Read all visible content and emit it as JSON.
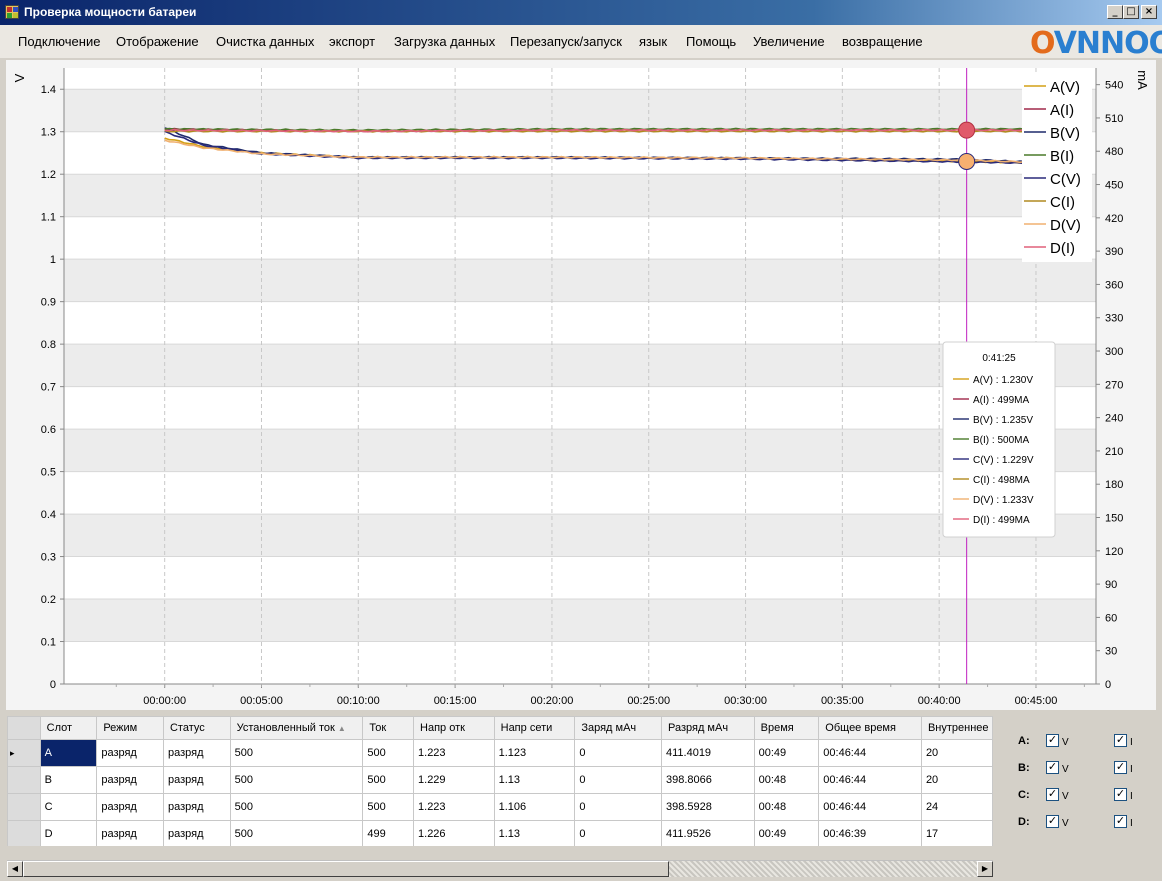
{
  "window": {
    "title": "Проверка мощности батареи",
    "min": "_",
    "max": "□",
    "close": "×"
  },
  "menu": [
    "Подключение",
    "Отображение",
    "Очистка данных",
    "экспорт",
    "Загрузка данных",
    "Перезапуск/запуск",
    "язык",
    "Помощь",
    "Увеличение",
    "возвращение"
  ],
  "logo": {
    "text": "OVNNOO"
  },
  "chart_data": {
    "type": "line",
    "ylabel_left": "V",
    "ylabel_right": "mA",
    "ylim_left": [
      0,
      1.45
    ],
    "ylim_right": [
      0,
      555
    ],
    "yticks_left": [
      "1.4",
      "1.3",
      "1.2",
      "1.1",
      "1",
      "0.9",
      "0.8",
      "0.7",
      "0.6",
      "0.5",
      "0.4",
      "0.3",
      "0.2",
      "0.1",
      "0"
    ],
    "yticks_right": [
      "540",
      "510",
      "480",
      "450",
      "420",
      "390",
      "360",
      "330",
      "300",
      "270",
      "240",
      "210",
      "180",
      "150",
      "120",
      "90",
      "60",
      "30",
      "0"
    ],
    "xticks": [
      "00:00:00",
      "00:05:00",
      "00:10:00",
      "00:15:00",
      "00:20:00",
      "00:25:00",
      "00:30:00",
      "00:35:00",
      "00:40:00",
      "00:45:00"
    ],
    "grid": true,
    "legend_position": "top-right",
    "series": [
      {
        "name": "A(V)",
        "axis": "left",
        "color": "#d4a017",
        "x_min": [
          0,
          2,
          5,
          10,
          20,
          30,
          41.4,
          46.7
        ],
        "y": [
          1.285,
          1.265,
          1.25,
          1.24,
          1.24,
          1.238,
          1.23,
          1.225
        ]
      },
      {
        "name": "A(I)",
        "axis": "right",
        "color": "#a0284a",
        "x_min": [
          0,
          10,
          20,
          30,
          41.4,
          46.7
        ],
        "y": [
          500,
          498,
          499,
          499,
          499,
          500
        ]
      },
      {
        "name": "B(V)",
        "axis": "left",
        "color": "#1f2a6b",
        "x_min": [
          0,
          2,
          5,
          10,
          20,
          30,
          41.4,
          46.7
        ],
        "y": [
          1.31,
          1.27,
          1.25,
          1.24,
          1.24,
          1.238,
          1.235,
          1.225
        ]
      },
      {
        "name": "B(I)",
        "axis": "right",
        "color": "#4a7a2a",
        "x_min": [
          0,
          10,
          20,
          30,
          41.4,
          46.7
        ],
        "y": [
          500,
          499,
          500,
          500,
          500,
          500
        ]
      },
      {
        "name": "C(V)",
        "axis": "left",
        "color": "#2a2a7a",
        "x_min": [
          0,
          2,
          5,
          10,
          20,
          30,
          41.4,
          46.7
        ],
        "y": [
          1.3,
          1.268,
          1.248,
          1.238,
          1.238,
          1.236,
          1.229,
          1.224
        ]
      },
      {
        "name": "C(I)",
        "axis": "right",
        "color": "#b08a20",
        "x_min": [
          0,
          10,
          20,
          30,
          41.4,
          46.7
        ],
        "y": [
          498,
          498,
          498,
          498,
          498,
          498
        ]
      },
      {
        "name": "D(V)",
        "axis": "left",
        "color": "#f0b070",
        "x_min": [
          0,
          2,
          5,
          10,
          20,
          30,
          41.4,
          46.7
        ],
        "y": [
          1.28,
          1.262,
          1.248,
          1.24,
          1.24,
          1.238,
          1.233,
          1.226
        ]
      },
      {
        "name": "D(I)",
        "axis": "right",
        "color": "#e0607a",
        "x_min": [
          0,
          10,
          20,
          30,
          41.4,
          46.7
        ],
        "y": [
          499,
          498,
          499,
          499,
          499,
          499
        ]
      }
    ],
    "cursor": {
      "x_min": 41.42,
      "time": "0:41:25"
    },
    "tooltip": {
      "time": "0:41:25",
      "rows": [
        "A(V) : 1.230V",
        "A(I) : 499MA",
        "B(V) : 1.235V",
        "B(I) : 500MA",
        "C(V) : 1.229V",
        "C(I) : 498MA",
        "D(V) : 1.233V",
        "D(I) : 499MA"
      ]
    }
  },
  "table": {
    "columns": [
      "Слот",
      "Режим",
      "Статус",
      "Установленный ток",
      "Ток",
      "Напр отк",
      "Напр сети",
      "Заряд мАч",
      "Разряд мАч",
      "Время",
      "Общее время",
      "Внутреннее"
    ],
    "sort_indicator": "▲",
    "rows": [
      [
        "A",
        "разряд",
        "разряд",
        "500",
        "500",
        "1.223",
        "1.123",
        "0",
        "411.4019",
        "00:49",
        "00:46:44",
        "20"
      ],
      [
        "B",
        "разряд",
        "разряд",
        "500",
        "500",
        "1.229",
        "1.13",
        "0",
        "398.8066",
        "00:48",
        "00:46:44",
        "20"
      ],
      [
        "C",
        "разряд",
        "разряд",
        "500",
        "500",
        "1.223",
        "1.106",
        "0",
        "398.5928",
        "00:48",
        "00:46:44",
        "24"
      ],
      [
        "D",
        "разряд",
        "разряд",
        "500",
        "499",
        "1.226",
        "1.13",
        "0",
        "411.9526",
        "00:49",
        "00:46:39",
        "17"
      ]
    ],
    "current_row_marker": "▸"
  },
  "checks": [
    {
      "slot": "A:",
      "v_label": "V",
      "i_label": "I",
      "v": true,
      "i": true
    },
    {
      "slot": "B:",
      "v_label": "V",
      "i_label": "I",
      "v": true,
      "i": true
    },
    {
      "slot": "C:",
      "v_label": "V",
      "i_label": "I",
      "v": true,
      "i": true
    },
    {
      "slot": "D:",
      "v_label": "V",
      "i_label": "I",
      "v": true,
      "i": true
    }
  ],
  "checkmark": "✓",
  "scroll": {
    "left": "◀",
    "right": "▶"
  }
}
